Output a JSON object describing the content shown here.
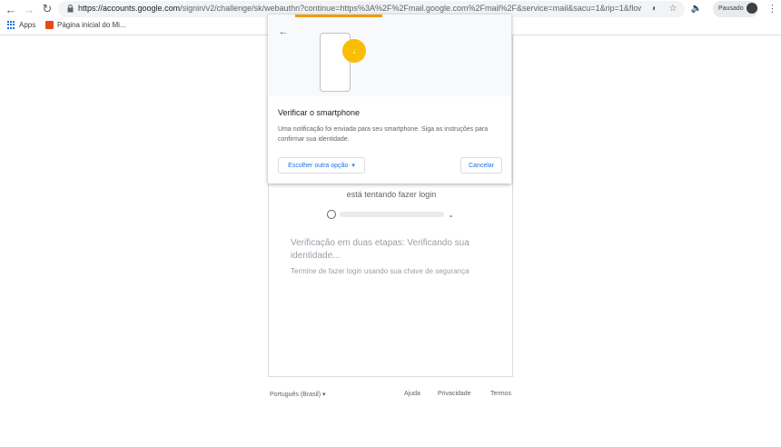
{
  "browser": {
    "url_host": "https://accounts.google.com",
    "url_rest": "/signin/v2/challenge/sk/webauthn?continue=https%3A%2F%2Fmail.google.com%2Fmail%2F&service=mail&sacu=1&rip=1&flowName=GL...",
    "profile_label": "Pausado",
    "bookmarks": [
      {
        "label": "Apps",
        "icon": "apps-grid-icon"
      },
      {
        "label": "Página inicial do Mi...",
        "icon": "office-icon"
      }
    ]
  },
  "page": {
    "partial_text": "está tentando fazer login",
    "heading": "Verificação em duas etapas: Verificando sua identidade...",
    "subtext": "Termine de fazer login usando sua chave de segurança"
  },
  "dialog": {
    "title": "Verificar o smartphone",
    "body": "Uma notificação foi enviada para seu smartphone. Siga as instruções para confirmar sua identidade.",
    "choose_option_label": "Escolher outra opção",
    "cancel_label": "Cancelar"
  },
  "footer": {
    "language": "Português (Brasil)",
    "help": "Ajuda",
    "privacy": "Privacidade",
    "terms": "Termos"
  },
  "colors": {
    "accent": "#1a73e8",
    "warning": "#fbbc04",
    "text_primary": "#202124",
    "text_secondary": "#5f6368"
  }
}
